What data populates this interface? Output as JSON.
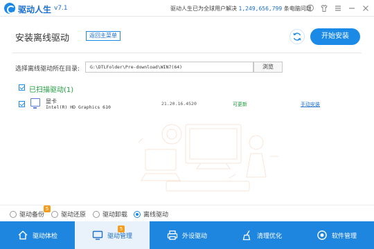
{
  "titlebar": {
    "app_name": "驱动人生",
    "version": "v7.1",
    "notice_prefix": "驱动人生已为全球用户解决",
    "notice_count": "1,249,656,799",
    "notice_suffix": "条电脑问题",
    "buttons": [
      "talk-icon",
      "shirt-icon",
      "menu-icon",
      "minimize-icon",
      "close-icon"
    ]
  },
  "header": {
    "title": "安装离线驱动",
    "back_label": "返回主菜单",
    "install_label": "开始安装"
  },
  "folder": {
    "label": "选择离线驱动所在目录:",
    "path": "G:\\DTLFolder\\Pre-download\\WIN7(64)",
    "browse_label": "浏览"
  },
  "scanned": {
    "title": "已扫描驱动(1)",
    "drivers": [
      {
        "type": "显卡",
        "name": "Intel(R) HD Graphics 610",
        "version": "21.20.16.4520",
        "status": "可更新",
        "action": "手动安装"
      }
    ]
  },
  "radio_options": [
    {
      "label": "驱动备份",
      "selected": false,
      "badge": "5"
    },
    {
      "label": "驱动还原",
      "selected": false
    },
    {
      "label": "驱动卸载",
      "selected": false
    },
    {
      "label": "离线驱动",
      "selected": true
    }
  ],
  "nav": [
    {
      "label": "驱动体检",
      "icon": "home-icon",
      "active": false
    },
    {
      "label": "驱动管理",
      "icon": "monitor-icon",
      "active": true,
      "badge": "5"
    },
    {
      "label": "外设驱动",
      "icon": "printer-icon",
      "active": false
    },
    {
      "label": "清理优化",
      "icon": "broom-icon",
      "active": false
    },
    {
      "label": "软件管理",
      "icon": "software-icon",
      "active": false
    }
  ],
  "colors": {
    "accent": "#1a8ae6",
    "nav_bg": "#1f86e0",
    "green": "#1b9a3b",
    "badge": "#f39c1e"
  }
}
